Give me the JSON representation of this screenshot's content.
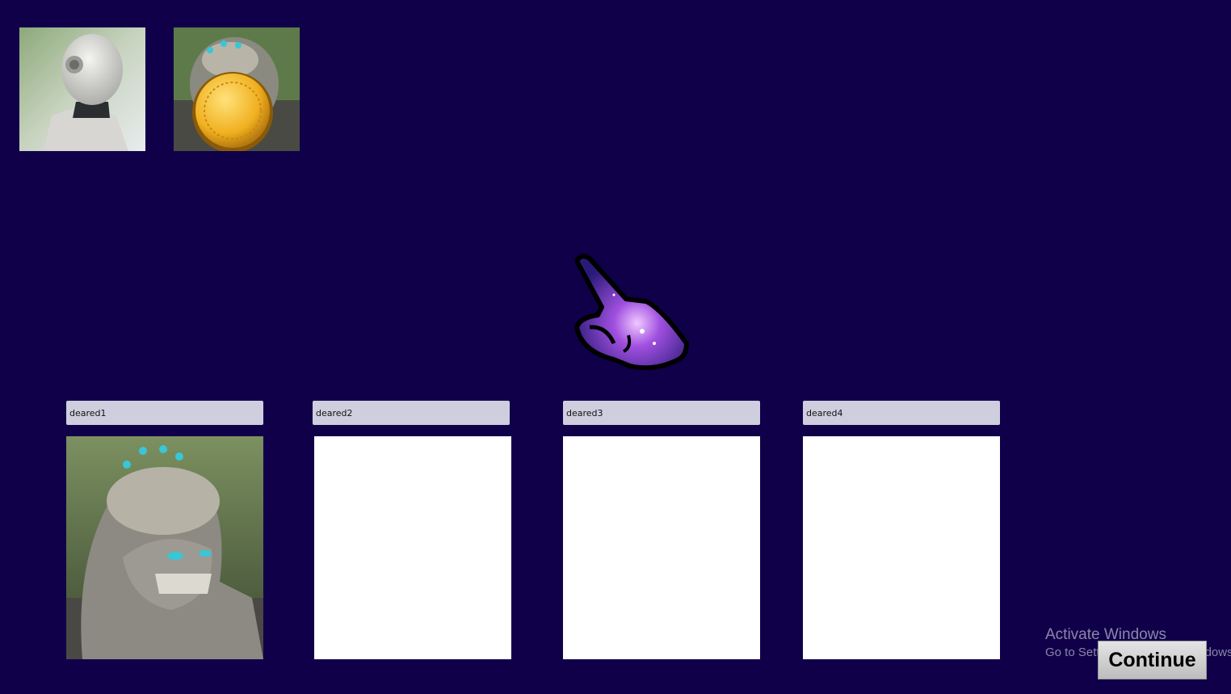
{
  "portraits": [
    {
      "name": "robot-portrait",
      "icon": "robot-helmet"
    },
    {
      "name": "creature-portrait",
      "icon": "creature-with-gold-coin"
    }
  ],
  "pointer": {
    "icon": "galaxy-pointing-hand-icon"
  },
  "slots": [
    {
      "label": "deared1",
      "filled": true
    },
    {
      "label": "deared2",
      "filled": false
    },
    {
      "label": "deared3",
      "filled": false
    },
    {
      "label": "deared4",
      "filled": false
    }
  ],
  "watermark": {
    "title": "Activate Windows",
    "subtitle": "Go to Settings to activate Windows."
  },
  "continue_label": "Continue",
  "colors": {
    "background": "#10004a",
    "label_bg": "#cfcede",
    "coin": "#f0b020"
  }
}
